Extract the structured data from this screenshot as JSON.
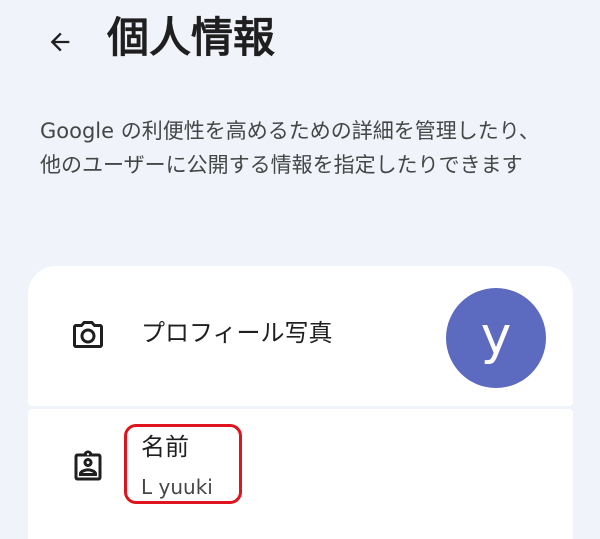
{
  "header": {
    "back_icon": "arrow-back-icon",
    "title": "個人情報"
  },
  "description": "Google の利便性を高めるための詳細を管理したり、他のユーザーに公開する情報を指定したりできます",
  "profile_photo": {
    "icon": "camera-icon",
    "label": "プロフィール写真",
    "avatar_letter": "y",
    "avatar_color": "#5c6bc0"
  },
  "name_row": {
    "icon": "badge-icon",
    "label": "名前",
    "value": "L yuuki",
    "highlight_color": "#e0141e"
  }
}
